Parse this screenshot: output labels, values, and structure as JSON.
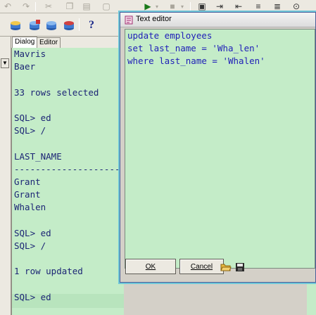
{
  "toolbar": {
    "row1_icons": [
      "undo-icon",
      "redo-icon",
      "cut-icon",
      "copy-icon",
      "paste-icon",
      "clear-icon",
      "run-icon",
      "run-dropdown-icon",
      "stop-icon",
      "stop-dropdown-icon",
      "run-script-icon",
      "indent-icon",
      "outdent-icon",
      "comment-icon",
      "uncomment-icon",
      "binoculars-icon"
    ],
    "row2_icons": [
      "connect-icon",
      "disconnect-icon",
      "commit-icon",
      "rollback-icon",
      "help-icon"
    ],
    "help_glyph": "?"
  },
  "tabs": [
    {
      "label": "Dialog"
    },
    {
      "label": "Editor"
    }
  ],
  "output": {
    "lines": [
      "Mavris",
      "Baer",
      "",
      "33 rows selected",
      "",
      "SQL> ed",
      "SQL> /",
      "",
      "LAST_NAME",
      "-------------------------",
      "Grant",
      "Grant",
      "Whalen",
      "",
      "SQL> ed",
      "SQL> /",
      "",
      "1 row updated",
      "",
      "SQL> ed"
    ]
  },
  "editor": {
    "title": "Text editor",
    "lines": [
      "update employees",
      "set last_name = 'Wha_len'",
      "where last_name = 'Whalen'"
    ],
    "ok_label": "OK",
    "cancel_label": "Cancel",
    "icons": [
      "open-folder-icon",
      "save-disk-icon"
    ]
  },
  "colors": {
    "output_bg": "#c4ecc8",
    "output_text": "#1c2575",
    "editor_text": "#2020b8"
  }
}
